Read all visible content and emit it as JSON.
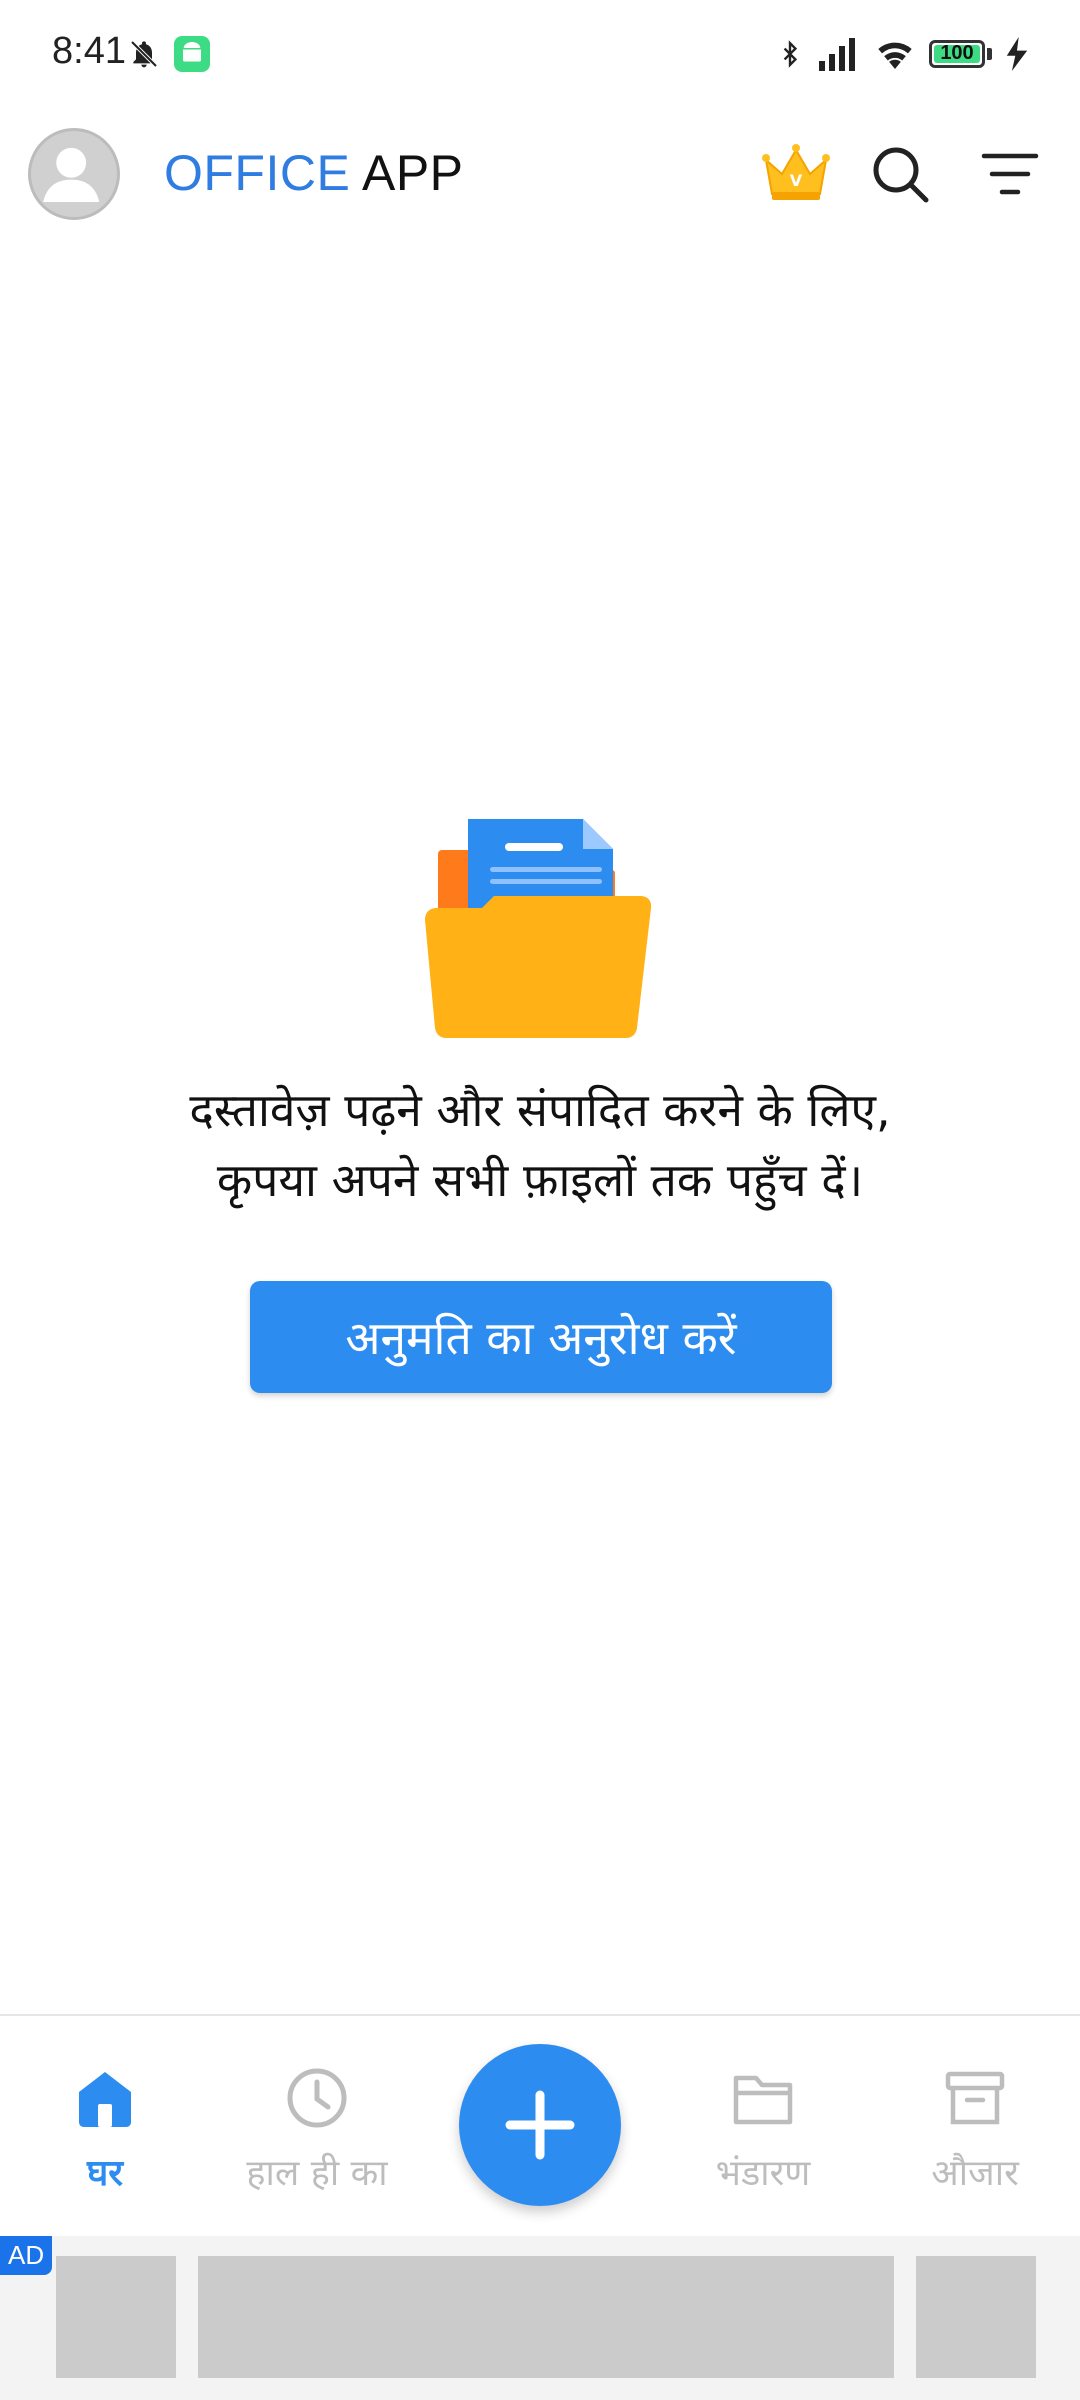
{
  "status_bar": {
    "time": "8:41",
    "battery": "100",
    "icons": [
      "bell-off-icon",
      "android-icon",
      "bluetooth-icon",
      "signal-icon",
      "wifi-icon",
      "battery-icon",
      "charging-icon"
    ]
  },
  "header": {
    "title_part1": "OFFICE",
    "title_part2": "APP",
    "crown_badge": "V"
  },
  "empty_state": {
    "line1": "दस्तावेज़ पढ़ने और संपादित करने के लिए,",
    "line2": "कृपया अपने सभी फ़ाइलों तक पहुँच दें।",
    "button_label": "अनुमति का अनुरोध करें"
  },
  "bottom_nav": {
    "items": [
      {
        "label": "घर",
        "icon": "home-icon",
        "active": true
      },
      {
        "label": "हाल ही का",
        "icon": "clock-icon",
        "active": false
      },
      {
        "label": "भंडारण",
        "icon": "folder-icon",
        "active": false
      },
      {
        "label": "औजार",
        "icon": "archive-icon",
        "active": false
      }
    ],
    "fab_icon": "plus-icon"
  },
  "ad": {
    "badge": "AD"
  },
  "colors": {
    "accent": "#2d8cf0",
    "title_blue": "#2f7de1",
    "folder_yellow": "#ffb116",
    "inactive": "#bdbdbd"
  }
}
